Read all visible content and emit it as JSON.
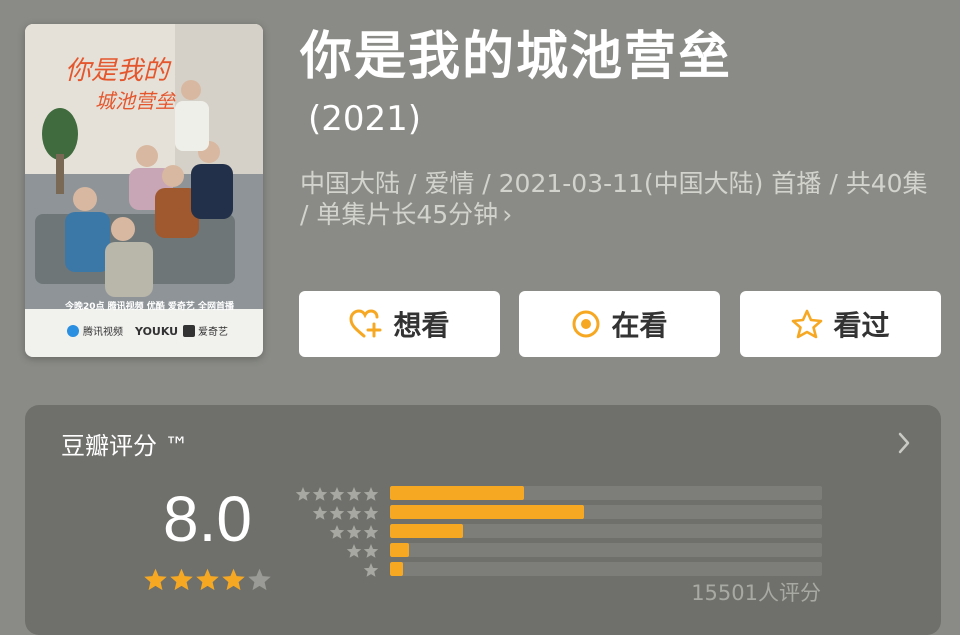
{
  "movie": {
    "title": "你是我的城池营垒",
    "year": "(2021)",
    "meta": "中国大陆 / 爱情 / 2021-03-11(中国大陆) 首播 / 共40集 / 单集片长45分钟",
    "meta_chevron": "›",
    "poster": {
      "icon": "poster-image",
      "lines": [
        "今晚20点 腾讯视频 优酷 爱奇艺 全网首播",
        "腾讯视频",
        "YOUKU",
        "爱奇艺"
      ]
    }
  },
  "actions": {
    "want": {
      "label": "想看",
      "icon": "heart-plus-icon"
    },
    "watching": {
      "label": "在看",
      "icon": "circle-dot-icon"
    },
    "watched": {
      "label": "看过",
      "icon": "star-outline-icon"
    }
  },
  "rating": {
    "title": "豆瓣评分 ™",
    "chevron": "›",
    "score": "8.0",
    "stars": 4,
    "count_text": "15501人评分",
    "distribution": [
      {
        "stars": 5,
        "fraction": 0.31
      },
      {
        "stars": 4,
        "fraction": 0.45
      },
      {
        "stars": 3,
        "fraction": 0.17
      },
      {
        "stars": 2,
        "fraction": 0.045
      },
      {
        "stars": 1,
        "fraction": 0.03
      }
    ]
  },
  "colors": {
    "background": "#8a8b86",
    "card": "#6f706b",
    "accent": "#f7a823",
    "star_empty": "#9a9b96"
  }
}
